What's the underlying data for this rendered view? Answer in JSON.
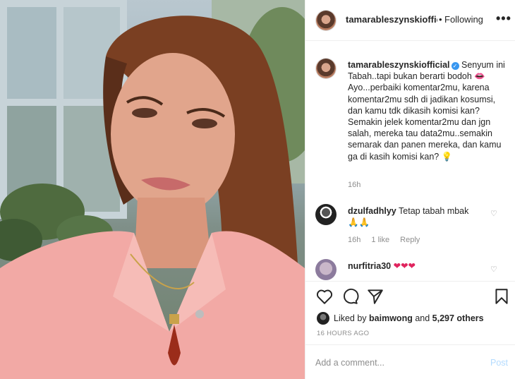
{
  "header": {
    "username": "tamarableszynskiofficial",
    "separator": "•",
    "follow_state": "Following",
    "more_icon": "more-horizontal-icon"
  },
  "caption": {
    "username": "tamarableszynskiofficial",
    "text_line1": " Senyum ini Tabah..tapi bukan berarti bodoh ",
    "text_line2": " Ayo...perbaiki komentar2mu, karena komentar2mu sdh di jadikan kosumsi, dan kamu tdk dikasih komisi kan? Semakin jelek komentar2mu dan jgn salah, mereka tau data2mu..semakin semarak dan panen mereka, dan kamu ga di kasih komisi kan? ",
    "time": "16h"
  },
  "comments": [
    {
      "username": "dzulfadhlyy",
      "text": " Tetap tabah mbak",
      "emoji": "🙏🙏",
      "time": "16h",
      "likes": "1 like",
      "reply": "Reply"
    },
    {
      "username": "nurfitria30",
      "text": " ❤❤❤"
    }
  ],
  "actions": {
    "liked_by_prefix": "Liked by ",
    "liked_by_user": "baimwong",
    "liked_by_middle": " and ",
    "liked_by_count": "5,297 others",
    "time_ago": "16 HOURS AGO"
  },
  "add_comment": {
    "placeholder": "Add a comment...",
    "post_label": "Post"
  },
  "colors": {
    "link_blue": "#3897f0",
    "post_disabled": "#b3dbff",
    "muted": "#8e8e8e"
  }
}
